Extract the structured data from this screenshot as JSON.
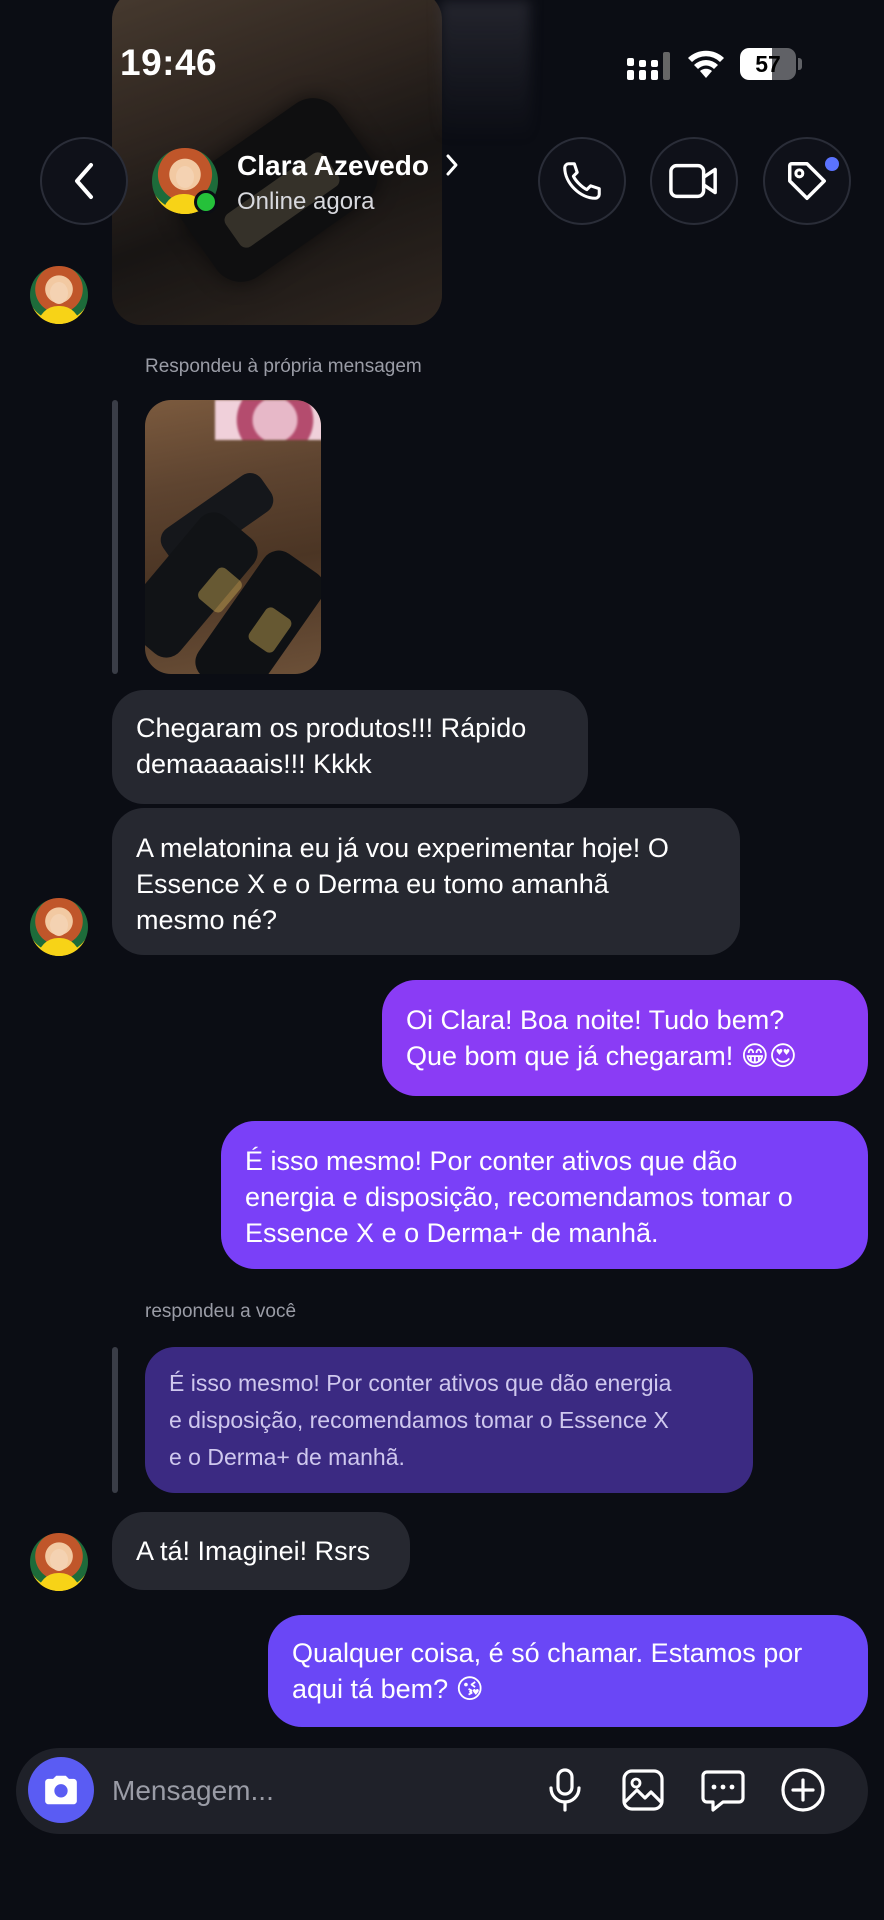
{
  "status_bar": {
    "time": "19:46",
    "battery": "57",
    "battery_level": 57
  },
  "header": {
    "contact_name": "Clara Azevedo",
    "contact_status": "Online agora",
    "icons": [
      "back-arrow-icon",
      "phone-icon",
      "video-camera-icon",
      "tag-icon"
    ]
  },
  "conversation": {
    "reply_label_1": "Respondeu à própria mensagem",
    "incoming_1": "Chegaram os produtos!!! Rápido\ndemaaaaais!!! Kkkk",
    "incoming_2": "A melatonina eu já vou experimentar hoje! O\nEssence X e o Derma eu tomo amanhã\nmesmo né?",
    "outgoing_1": "Oi Clara! Boa noite! Tudo bem?\nQue bom que já chegaram! 😁😍",
    "outgoing_2": "É isso mesmo! Por conter ativos que dão\nenergia e disposição, recomendamos tomar o\nEssence X e o Derma+ de manhã.",
    "reply_label_2": "respondeu a você",
    "quoted_reply": "É isso mesmo! Por conter ativos que dão energia\ne disposição, recomendamos tomar o Essence X\ne o Derma+ de manhã.",
    "incoming_3": "A tá! Imaginei! Rsrs",
    "outgoing_3": "Qualquer coisa, é só chamar. Estamos por\naqui tá bem? 😘"
  },
  "composer": {
    "placeholder": "Mensagem...",
    "icons": [
      "camera-icon",
      "microphone-icon",
      "image-icon",
      "message-icon",
      "plus-icon"
    ]
  },
  "colors": {
    "background": "#0b0d14",
    "incoming_bubble": "#262830",
    "outgoing_bubble_top": "#8a3cf5",
    "outgoing_bubble_bottom": "#6a47f6",
    "online": "#25c13a",
    "accent": "#5a5cf3"
  }
}
